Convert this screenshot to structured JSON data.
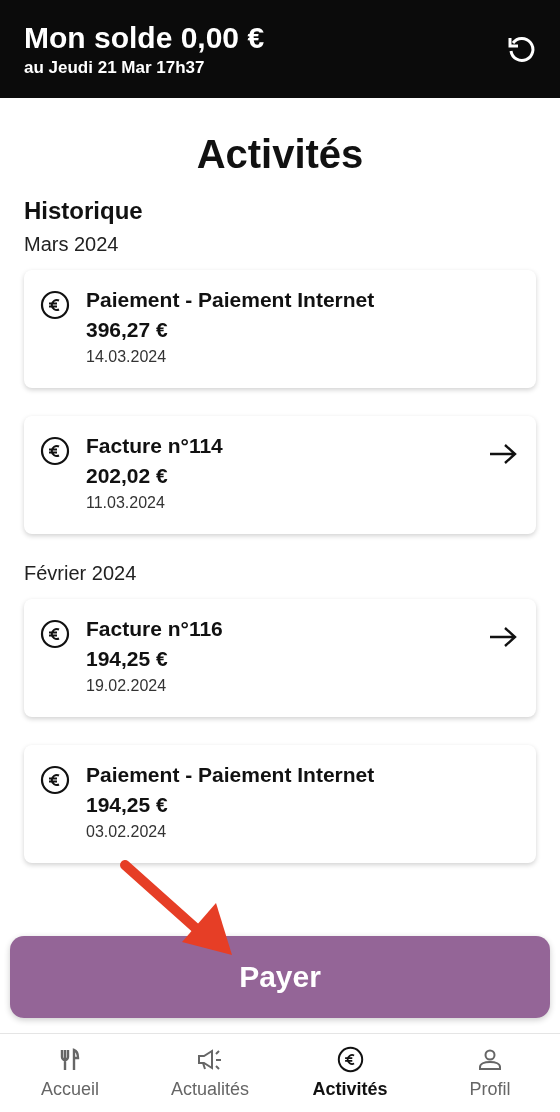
{
  "header": {
    "balance": "Mon solde 0,00 €",
    "as_of": "au Jeudi 21 Mar 17h37"
  },
  "page_title": "Activités",
  "section_title": "Historique",
  "groups": [
    {
      "month": "Mars 2024",
      "items": [
        {
          "title": "Paiement - Paiement Internet",
          "amount": "396,27 €",
          "date": "14.03.2024",
          "has_link": false
        },
        {
          "title": "Facture n°114",
          "amount": "202,02 €",
          "date": "11.03.2024",
          "has_link": true
        }
      ]
    },
    {
      "month": "Février 2024",
      "items": [
        {
          "title": "Facture n°116",
          "amount": "194,25 €",
          "date": "19.02.2024",
          "has_link": true
        },
        {
          "title": "Paiement - Paiement Internet",
          "amount": "194,25 €",
          "date": "03.02.2024",
          "has_link": false
        }
      ]
    }
  ],
  "pay_button": "Payer",
  "nav": [
    {
      "label": "Accueil",
      "kind": "home",
      "selected": false
    },
    {
      "label": "Actualités",
      "kind": "news",
      "selected": false
    },
    {
      "label": "Activités",
      "kind": "activity",
      "selected": true
    },
    {
      "label": "Profil",
      "kind": "profile",
      "selected": false
    }
  ]
}
